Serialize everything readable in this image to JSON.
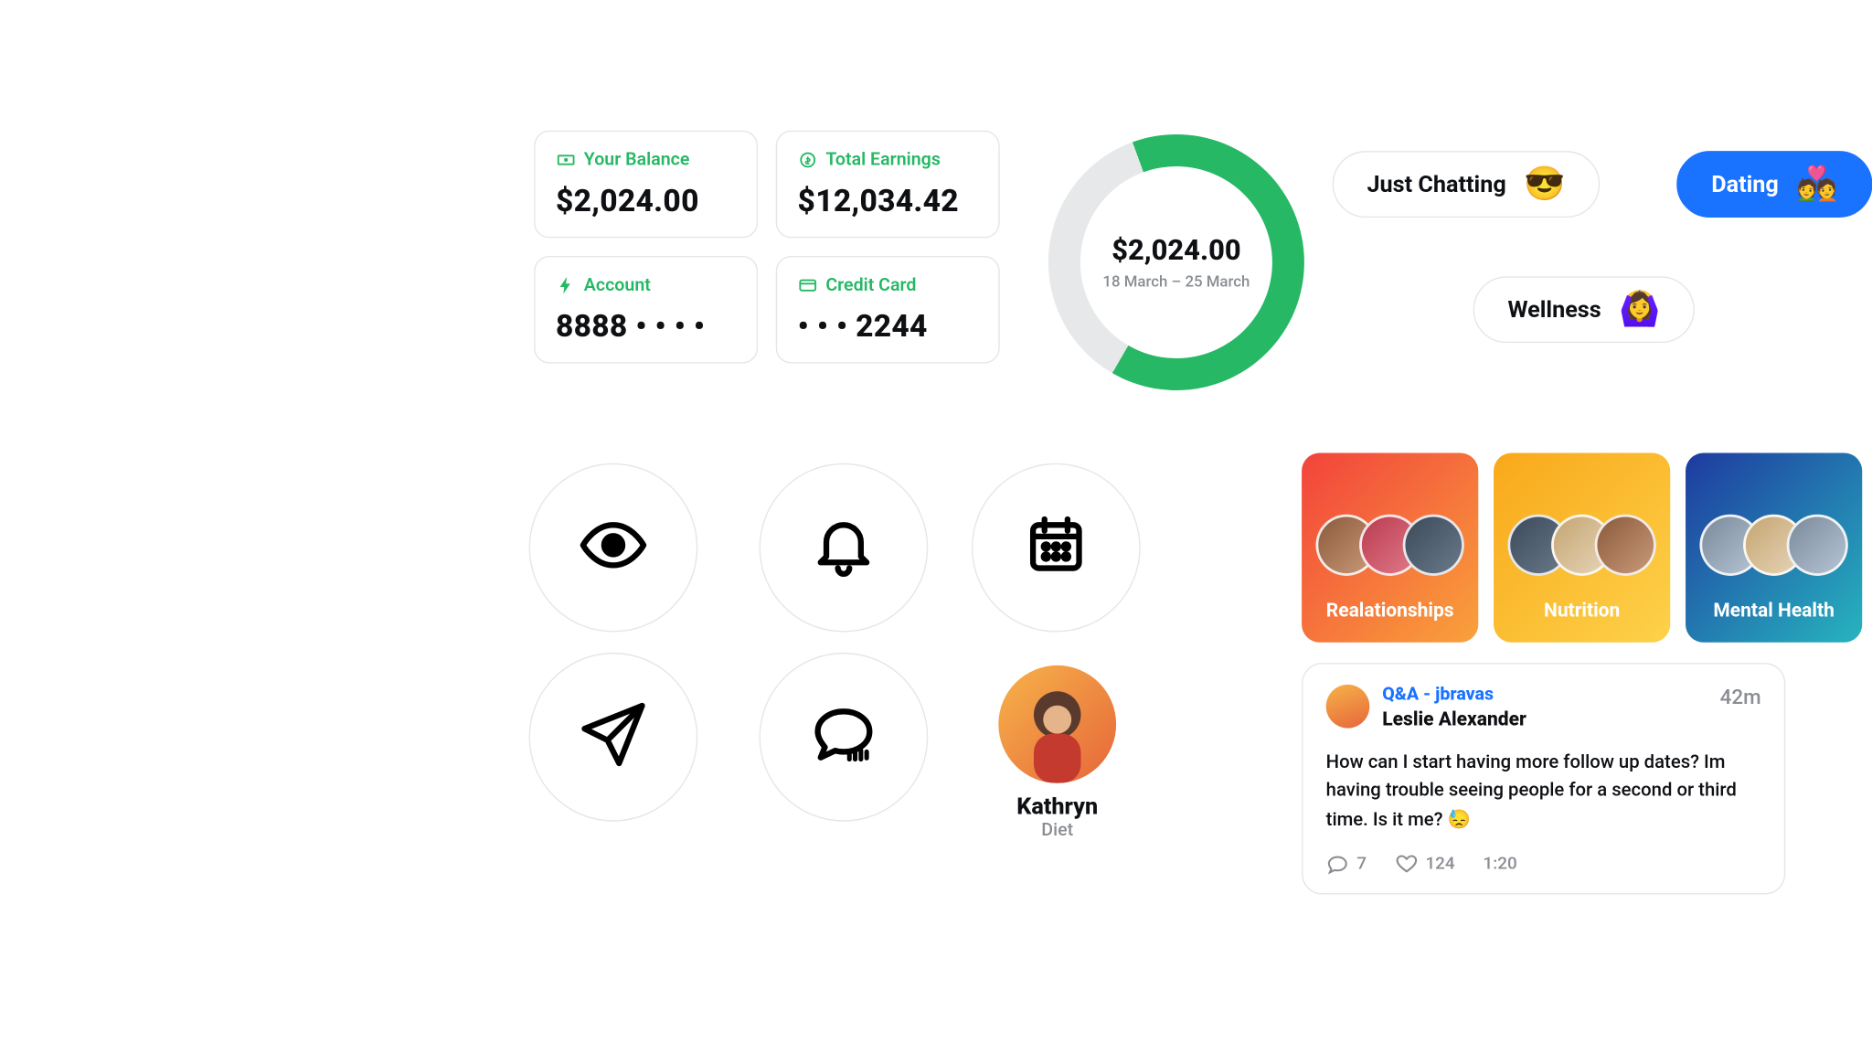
{
  "stats": {
    "balance": {
      "label": "Your Balance",
      "value": "$2,024.00"
    },
    "earnings": {
      "label": "Total Earnings",
      "value": "$12,034.42"
    },
    "account": {
      "label": "Account",
      "value": "8888 • • • •"
    },
    "card": {
      "label": "Credit Card",
      "value": "• • • 2244"
    }
  },
  "donut": {
    "amount": "$2,024.00",
    "range": "18 March – 25 March",
    "progress_deg": 230
  },
  "chips": {
    "chatting": {
      "label": "Just Chatting",
      "emoji": "😎"
    },
    "dating": {
      "label": "Dating",
      "emoji": "💑"
    },
    "wellness": {
      "label": "Wellness",
      "emoji": "🙆‍♀️"
    }
  },
  "user": {
    "name": "Kathryn",
    "tag": "Diet"
  },
  "categories": {
    "relationships": "Realationships",
    "nutrition": "Nutrition",
    "mental": "Mental Health"
  },
  "post": {
    "channel": "Q&A - jbravas",
    "author": "Leslie Alexander",
    "age": "42m",
    "body": "How can I start having more follow up dates? Im having trouble seeing people for a second or third time. Is it me? 😓",
    "comments": "7",
    "likes": "124",
    "duration": "1:20"
  }
}
